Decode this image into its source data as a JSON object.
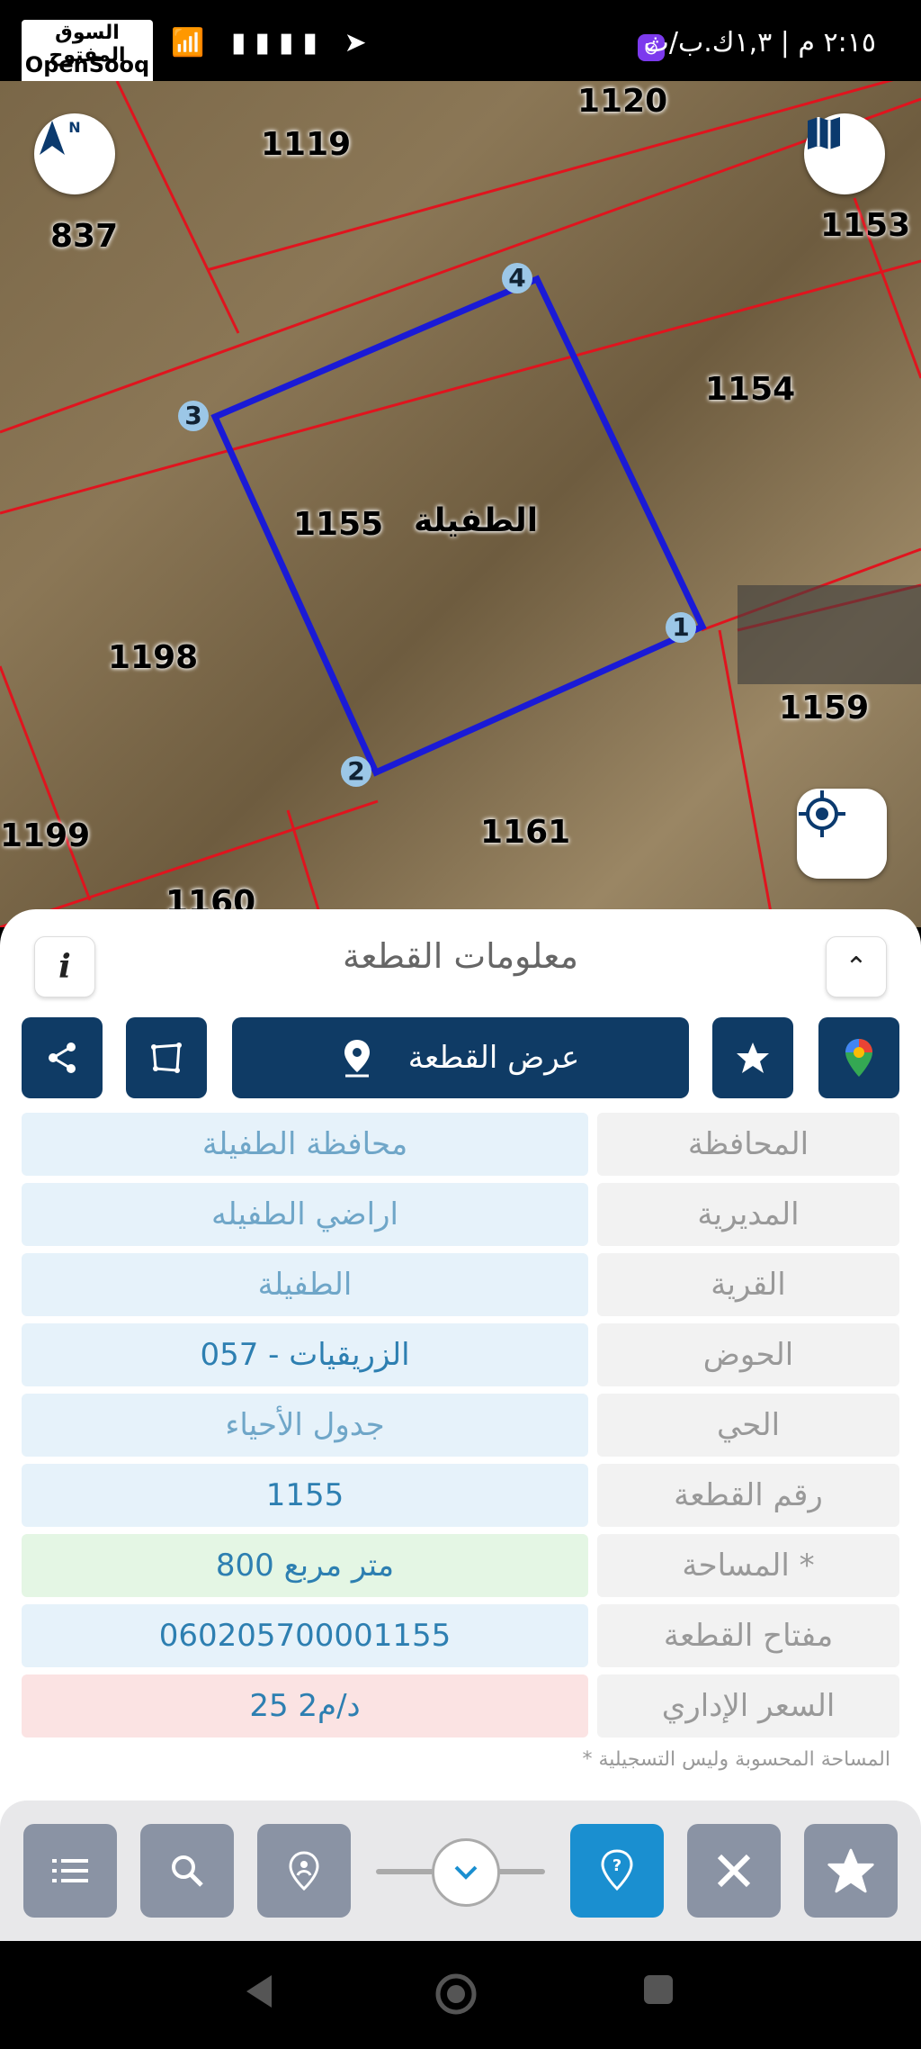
{
  "status_bar": {
    "time": "٢:١٥ م | ١,٣ك.ب/ث",
    "signal_icons": "📶 ▮▮▮▮ ➤",
    "brand_ar": "السوق المفتوح",
    "brand_en": "OpenSooq"
  },
  "map": {
    "compass_letter": "N",
    "plots": [
      "1120",
      "1119",
      "837",
      "1153",
      "1154",
      "1155",
      "1198",
      "1159",
      "1199",
      "1161",
      "1160"
    ],
    "plot_name": "الطفيلة",
    "vertices": [
      "1",
      "2",
      "3",
      "4"
    ],
    "colors": {
      "boundary": "#e0141e",
      "selected": "#1a1ad6"
    },
    "icons": [
      "compass-icon",
      "map-layers-icon",
      "my-location-icon"
    ]
  },
  "sheet": {
    "title": "معلومات القطعة",
    "info_label": "i",
    "collapse_icon": "⌃",
    "show_plot_label": "عرض القطعة",
    "icons": [
      "share-icon",
      "polygon-icon",
      "pin-icon",
      "star-icon",
      "google-maps-icon"
    ]
  },
  "rows": [
    {
      "label": "المحافظة",
      "value": "محافظة الطفيلة"
    },
    {
      "label": "المديرية",
      "value": "اراضي الطفيله"
    },
    {
      "label": "القرية",
      "value": "الطفيلة"
    },
    {
      "label": "الحوض",
      "value": "الزريقيات - 057"
    },
    {
      "label": "الحي",
      "value": "جدول الأحياء"
    },
    {
      "label": "رقم القطعة",
      "value": "1155"
    },
    {
      "label": "المساحة *",
      "value": "800 متر مربع"
    },
    {
      "label": "مفتاح القطعة",
      "value": "060205700001155"
    },
    {
      "label": "السعر الإداري",
      "value": "25 د/م2"
    }
  ],
  "footnote": "* المساحة المحسوبة وليس التسجيلية",
  "toolbar": {
    "icons": [
      "list-icon",
      "search-icon",
      "location-pin-icon",
      "chevron-down-icon",
      "help-icon",
      "measure-icon",
      "star-icon"
    ]
  }
}
